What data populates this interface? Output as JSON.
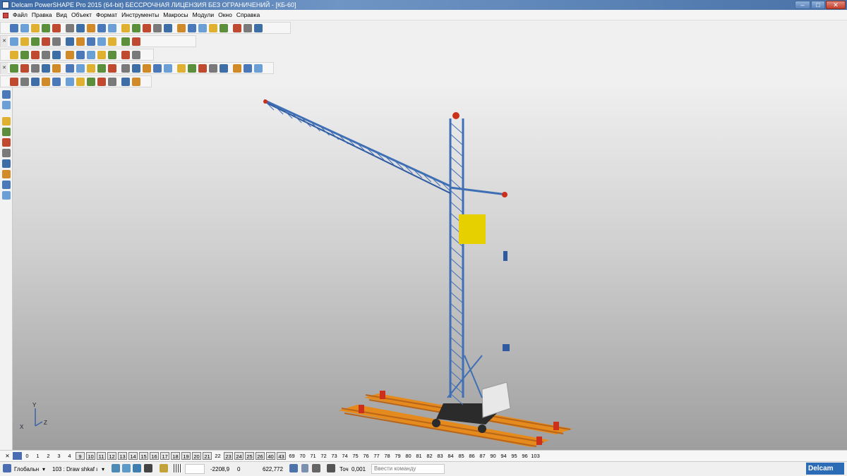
{
  "window": {
    "title": "Delcam PowerSHAPE Pro 2015 (64-bit) БЕССРОЧНАЯ ЛИЦЕНЗИЯ БЕЗ ОГРАНИЧЕНИЙ - [КБ-60]",
    "controls": {
      "minimize": "–",
      "maximize": "□",
      "close": "✕"
    },
    "doc_controls": {
      "minimize": "–",
      "restore": "▫",
      "close": "✕"
    }
  },
  "menu": {
    "items": [
      "Файл",
      "Правка",
      "Вид",
      "Объект",
      "Формат",
      "Инструменты",
      "Макросы",
      "Модули",
      "Окно",
      "Справка"
    ]
  },
  "toolbars": {
    "close_glyph": "✕",
    "rows": [
      [
        "new-file-icon",
        "open-folder-icon",
        "save-icon",
        "save-as-icon",
        "print-icon",
        "cut-icon",
        "copy-icon",
        "paste-icon",
        "delete-icon",
        "undo-icon",
        "redo-icon",
        "redraw-icon",
        "select-icon",
        "dimension-icon",
        "line-icon",
        "circle-icon",
        "curve-icon",
        "text-icon",
        "surface-icon",
        "solid-icon",
        "shaded-icon",
        "assembly-icon",
        "wireframe-icon"
      ],
      [
        "view-top-icon",
        "view-front-icon",
        "view-iso-icon",
        "view-rotate-icon",
        "view-pan-icon",
        "zoom-in-icon",
        "zoom-out-icon",
        "zoom-fit-icon",
        "shade-icon",
        "material-icon",
        "light-icon",
        "hand-icon"
      ],
      [
        "new-doc-icon",
        "doc-icon",
        "model-icon",
        "assembly-icon",
        "color-ball-icon",
        "arrow-icon",
        "surface-icon",
        "cube-icon",
        "layer-icon",
        "export-icon",
        "tree-icon",
        "part-icon"
      ],
      [
        "blend-icon",
        "shell-icon",
        "extrude-icon",
        "box-icon",
        "cut-icon",
        "revolve-icon",
        "sweep-icon",
        "fillet-icon",
        "chamfer-icon",
        "draft-icon",
        "hole-icon",
        "pattern-icon",
        "mirror-icon",
        "boolean-add-icon",
        "boolean-sub-icon",
        "boolean-int-icon",
        "split-icon",
        "thicken-icon",
        "offset-icon",
        "trim-icon",
        "extend-icon",
        "loft-icon",
        "replace-icon",
        "history-icon",
        "tree-icon"
      ],
      [
        "sphere-icon",
        "cone-icon",
        "axis-icon",
        "solid-icon",
        "feature-icon",
        "face-icon",
        "box-icon",
        "cube-icon",
        "mesh-icon",
        "pattern-icon",
        "move-icon",
        "shade-icon",
        "wireframe-icon"
      ]
    ],
    "left_column": [
      "select-arrow-icon",
      "model-tree-icon",
      "surface-tool-icon",
      "solid-tool-icon",
      "extrude-tool-icon",
      "wireframe-tool-icon",
      "shell-tool-icon",
      "rotate-tool-icon",
      "move-tool-icon",
      "assembly-tool-icon"
    ]
  },
  "viewport": {
    "model": "КБ-60",
    "axis_labels": {
      "y": "Y",
      "x": "X",
      "z": "Z"
    },
    "colors": {
      "lattice": "#3f6fb4",
      "lattice_dark": "#2f5aa0",
      "cab": "#e6d000",
      "rails": "#e58a1c",
      "rail_bolts": "#b8651a",
      "stops": "#cc2f1a",
      "counterweight": "#e8e8e8",
      "undercarriage": "#2b2b2b"
    }
  },
  "levels": {
    "numbers": [
      "0",
      "1",
      "2",
      "3",
      "4",
      "9",
      "10",
      "11",
      "12",
      "13",
      "14",
      "15",
      "16",
      "17",
      "18",
      "19",
      "20",
      "21",
      "22",
      "23",
      "24",
      "25",
      "26",
      "40",
      "43",
      "69",
      "70",
      "71",
      "72",
      "73",
      "74",
      "75",
      "76",
      "77",
      "78",
      "79",
      "80",
      "81",
      "82",
      "83",
      "84",
      "85",
      "86",
      "87",
      "90",
      "94",
      "95",
      "96",
      "103"
    ],
    "boxed": [
      "9",
      "10",
      "11",
      "12",
      "13",
      "14",
      "15",
      "16",
      "17",
      "18",
      "19",
      "20",
      "21",
      "23",
      "24",
      "25",
      "26",
      "40",
      "43"
    ]
  },
  "status": {
    "workplane": "Глобальн",
    "level_select": "103 : Draw shkaf ι",
    "coord_x": "-2208,9",
    "coord_y": "0",
    "coord_z": "622,772",
    "tolerance_label": "Точ",
    "tolerance_value": "0,001",
    "command_placeholder": "Ввести команду",
    "logo": "Delcam"
  }
}
